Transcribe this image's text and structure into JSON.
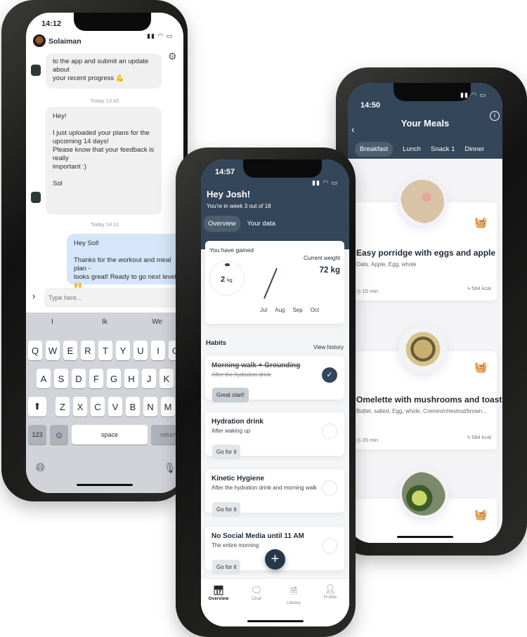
{
  "chat_phone": {
    "time": "14:12",
    "contact": "Solaiman",
    "messages": [
      {
        "text": "to the app and submit an update about\nyour recent progress 💪",
        "from": "coach"
      },
      {
        "timestamp": "Today 13:42"
      },
      {
        "text": "Hey!\n\nI just uploaded your plans for the\nupcoming 14 days!\nPlease know that your feedback is really\nimportant :)\n\nSol",
        "from": "coach"
      },
      {
        "timestamp": "Today 14:11"
      },
      {
        "text": "Hey Sol!\n\nThanks for the workout and meal plan -\nlooks great! Ready to go next level! 🙌",
        "from": "me"
      }
    ],
    "input_placeholder": "Type here...",
    "suggestions": [
      "I",
      "Ik",
      "We"
    ],
    "keyboard": {
      "row1": [
        "Q",
        "W",
        "E",
        "R",
        "T",
        "Y",
        "U",
        "I",
        "O",
        "P"
      ],
      "row2": [
        "A",
        "S",
        "D",
        "F",
        "G",
        "H",
        "J",
        "K",
        "L"
      ],
      "row3": [
        "Z",
        "X",
        "C",
        "V",
        "B",
        "N",
        "M"
      ],
      "numbers": "123",
      "space": "space",
      "return": "return"
    }
  },
  "overview_phone": {
    "time": "14:57",
    "greeting": "Hey Josh!",
    "subtitle": "You're in week 3 out of 18",
    "tabs": [
      "Overview",
      "Your data"
    ],
    "gained_label": "You have gained",
    "gained_value": "2",
    "gained_unit": "kg",
    "current_weight_label": "Current weight",
    "current_weight": "72 kg",
    "months": [
      "Jul",
      "Aug",
      "Sep",
      "Oct"
    ],
    "habits_title": "Habits",
    "view_history": "View history",
    "habits": [
      {
        "title": "Morning walk + Grounding",
        "subtitle": "After the hydration drink",
        "button": "Great start!",
        "done": true
      },
      {
        "title": "Hydration drink",
        "subtitle": "After waking up",
        "button": "Go for it",
        "done": false
      },
      {
        "title": "Kinetic Hygiene",
        "subtitle": "After the hydration drink and morning walk",
        "button": "Go for it",
        "done": false
      },
      {
        "title": "No Social Media until 11 AM",
        "subtitle": "The entire morning",
        "button": "Go for it",
        "done": false
      }
    ],
    "nav": [
      "Overview",
      "Chat",
      "Library",
      "Profile"
    ],
    "accent": "#34465a"
  },
  "meals_phone": {
    "time": "14:50",
    "title": "Your Meals",
    "tabs": [
      "Breakfast",
      "Lunch",
      "Snack 1",
      "Dinner"
    ],
    "meals": [
      {
        "title": "Easy porridge with eggs and apple",
        "ingredients": "Oats, Apple, Egg, whole",
        "time": "10 min",
        "kcal": "584 kcal"
      },
      {
        "title": "Omelette with mushrooms and toast",
        "ingredients": "Butter, salted, Egg, whole, Cremini/chestnut/brown...",
        "time": "20 min",
        "kcal": "584 kcal"
      }
    ]
  }
}
